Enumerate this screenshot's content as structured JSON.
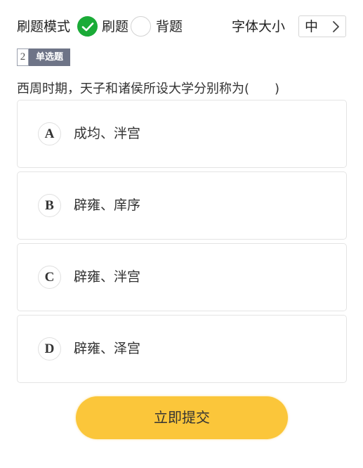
{
  "header": {
    "mode_label": "刷题模式",
    "mode_options": [
      {
        "label": "刷题",
        "selected": true
      },
      {
        "label": "背题",
        "selected": false
      }
    ],
    "font_size_label": "字体大小",
    "font_size_value": "中"
  },
  "question": {
    "number": "2",
    "type": "单选题",
    "text": "西周时期，天子和诸侯所设大学分别称为(　　)",
    "options": [
      {
        "letter": "A",
        "text": "成均、泮宫"
      },
      {
        "letter": "B",
        "text": "辟雍、庠序"
      },
      {
        "letter": "C",
        "text": "辟雍、泮宫"
      },
      {
        "letter": "D",
        "text": "辟雍、泽宫"
      }
    ]
  },
  "submit_label": "立即提交",
  "colors": {
    "check_green": "#1aab37",
    "badge_gray": "#6e7487",
    "submit_yellow": "#fbc63a"
  }
}
